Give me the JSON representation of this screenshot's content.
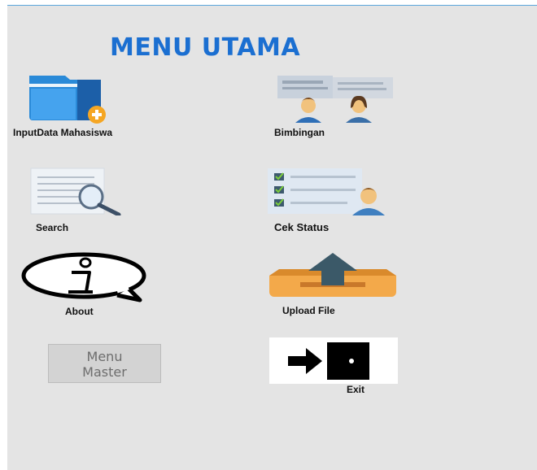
{
  "window": {
    "title": "MENU UTAMA"
  },
  "menu": {
    "input_data": {
      "label": "InputData Mahasiswa",
      "icon": "folder-add-icon"
    },
    "bimbingan": {
      "label": "Bimbingan",
      "icon": "people-icon"
    },
    "search": {
      "label": "Search",
      "icon": "search-icon"
    },
    "cek_status": {
      "label": "Cek Status",
      "icon": "checklist-user-icon"
    },
    "about": {
      "label": "About",
      "icon": "info-bubble-icon"
    },
    "upload_file": {
      "label": "Upload File",
      "icon": "upload-box-icon"
    },
    "menu_master": {
      "label_line1": "Menu",
      "label_line2": "Master"
    },
    "exit": {
      "label": "Exit",
      "icon": "exit-door-icon"
    }
  },
  "colors": {
    "title": "#1b6fd1",
    "background": "#e4e4e4",
    "folder_blue": "#2a8ad8",
    "plus_orange": "#f5a623",
    "box_orange": "#f3a94a",
    "arrow_dark": "#3b5968"
  }
}
